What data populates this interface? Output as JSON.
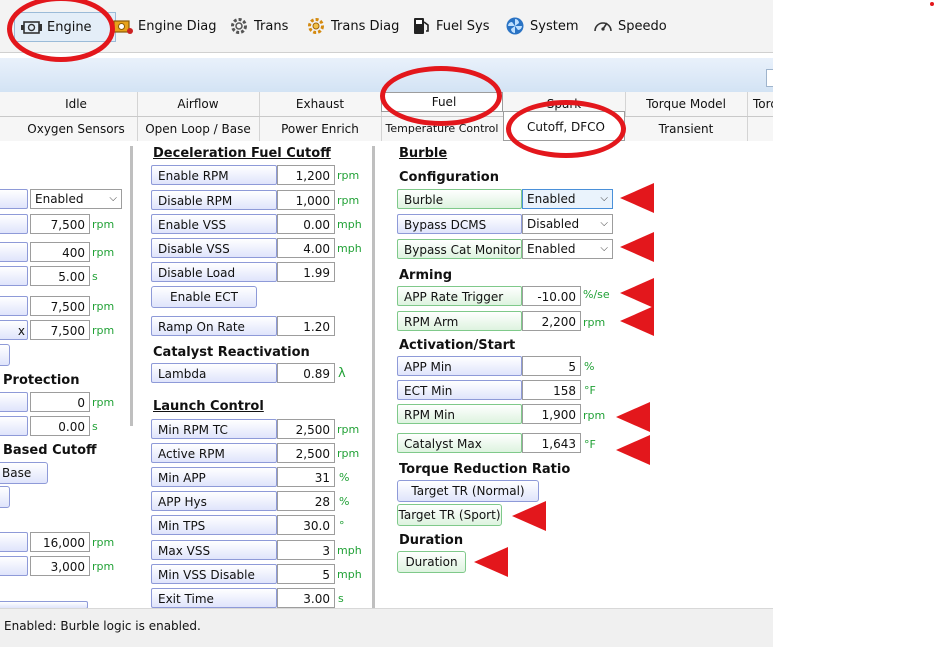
{
  "toolbar": {
    "items": [
      {
        "label": "Engine",
        "icon": "engine-icon"
      },
      {
        "label": "Engine Diag",
        "icon": "engine-diag-icon"
      },
      {
        "label": "Trans",
        "icon": "gear-icon"
      },
      {
        "label": "Trans Diag",
        "icon": "gear-diag-icon"
      },
      {
        "label": "Fuel Sys",
        "icon": "fuel-pump-icon"
      },
      {
        "label": "System",
        "icon": "fan-icon"
      },
      {
        "label": "Speedo",
        "icon": "speedometer-icon"
      }
    ]
  },
  "tabs_top": [
    "Idle",
    "Airflow",
    "Exhaust",
    "Fuel",
    "Spark",
    "Torque Model",
    "Torq"
  ],
  "tabs_bottom": [
    "Oxygen Sensors",
    "Open Loop / Base",
    "Power Enrich",
    "Temperature Control",
    "Cutoff, DFCO",
    "Transient"
  ],
  "left_column": {
    "select_value": "Enabled",
    "values": [
      "7,500",
      "400",
      "5.00",
      "7,500",
      "7,500"
    ],
    "units": [
      "rpm",
      "rpm",
      "s",
      "rpm",
      "rpm"
    ],
    "row_label_fragment": "x",
    "protection_heading": "Protection",
    "protection_values": [
      "0",
      "0.00"
    ],
    "protection_units": [
      "rpm",
      "s"
    ],
    "based_cutoff_heading": "Based Cutoff",
    "base_button": "Base",
    "bottom_values": [
      "16,000",
      "3,000"
    ],
    "bottom_units": [
      "rpm",
      "rpm"
    ]
  },
  "dfco": {
    "heading": "Deceleration Fuel Cutoff",
    "rows": [
      {
        "label": "Enable RPM",
        "value": "1,200",
        "unit": "rpm"
      },
      {
        "label": "Disable RPM",
        "value": "1,000",
        "unit": "rpm"
      },
      {
        "label": "Enable VSS",
        "value": "0.00",
        "unit": "mph"
      },
      {
        "label": "Disable VSS",
        "value": "4.00",
        "unit": "mph"
      },
      {
        "label": "Disable Load",
        "value": "1.99",
        "unit": ""
      }
    ],
    "enable_ect_button": "Enable ECT",
    "ramp_label": "Ramp On Rate",
    "ramp_value": "1.20"
  },
  "catalyst": {
    "heading": "Catalyst Reactivation",
    "lambda_label": "Lambda",
    "lambda_value": "0.89",
    "lambda_unit": "λ"
  },
  "launch": {
    "heading": "Launch Control",
    "rows": [
      {
        "label": "Min RPM TC",
        "value": "2,500",
        "unit": "rpm"
      },
      {
        "label": "Active RPM",
        "value": "2,500",
        "unit": "rpm"
      },
      {
        "label": "Min APP",
        "value": "31",
        "unit": "%"
      },
      {
        "label": "APP Hys",
        "value": "28",
        "unit": "%"
      },
      {
        "label": "Min TPS",
        "value": "30.0",
        "unit": "°"
      },
      {
        "label": "Max VSS",
        "value": "3",
        "unit": "mph"
      },
      {
        "label": "Min VSS Disable",
        "value": "5",
        "unit": "mph"
      },
      {
        "label": "Exit Time",
        "value": "3.00",
        "unit": "s"
      }
    ]
  },
  "burble": {
    "heading": "Burble",
    "configuration_heading": "Configuration",
    "config_rows": [
      {
        "label": "Burble",
        "value": "Enabled"
      },
      {
        "label": "Bypass DCMS",
        "value": "Disabled"
      },
      {
        "label": "Bypass Cat Monitor",
        "value": "Enabled"
      }
    ],
    "arming_heading": "Arming",
    "arming_rows": [
      {
        "label": "APP Rate Trigger",
        "value": "-10.00",
        "unit": "%/se"
      },
      {
        "label": "RPM Arm",
        "value": "2,200",
        "unit": "rpm"
      }
    ],
    "activation_heading": "Activation/Start",
    "activation_rows": [
      {
        "label": "APP Min",
        "value": "5",
        "unit": "%"
      },
      {
        "label": "ECT Min",
        "value": "158",
        "unit": "°F"
      },
      {
        "label": "RPM Min",
        "value": "1,900",
        "unit": "rpm"
      },
      {
        "label": "Catalyst Max",
        "value": "1,643",
        "unit": "°F"
      }
    ],
    "torque_heading": "Torque Reduction Ratio",
    "target_normal_button": "Target TR (Normal)",
    "target_sport_button": "Target TR (Sport)",
    "duration_heading": "Duration",
    "duration_button": "Duration"
  },
  "status": {
    "text": "Enabled: Burble logic is enabled."
  },
  "colors": {
    "annotation_red": "#e3171c",
    "unit_green": "#21a136",
    "label_blue_border": "#8e9ad8",
    "label_green_border": "#7fc98a"
  }
}
